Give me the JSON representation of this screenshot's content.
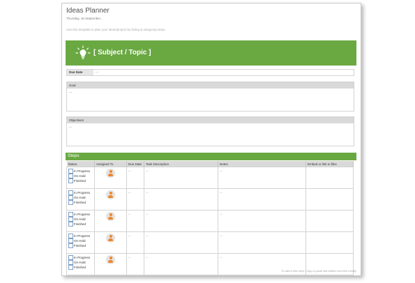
{
  "header": {
    "title": "Ideas Planner",
    "date": "Thursday, 15 September ,",
    "hint": "Use this template to plan your ideas/project by listing & assigning steps"
  },
  "banner": {
    "title": "[ Subject / Topic ]",
    "color": "#6aa842",
    "icon": "lightbulb-icon"
  },
  "due": {
    "label": "Due Date",
    "value": "..."
  },
  "goal": {
    "label": "Goal",
    "value": "..."
  },
  "objectives": {
    "label": "Objectives",
    "value": "..."
  },
  "steps": {
    "title": "Steps",
    "columns": {
      "status": "Status",
      "assigned": "Assigned To",
      "due": "Due Date",
      "task": "Task Description",
      "notes": "Notes",
      "files": "Embed or link to files"
    },
    "status_options": [
      "In Progress",
      "On Hold",
      "Finished"
    ],
    "rows": [
      {
        "due": "...",
        "task": "...",
        "notes": "..."
      },
      {
        "due": "...",
        "task": "...",
        "notes": "..."
      },
      {
        "due": "...",
        "task": "...",
        "notes": "..."
      },
      {
        "due": "...",
        "task": "...",
        "notes": "..."
      },
      {
        "due": "...",
        "task": "...",
        "notes": "..."
      }
    ]
  },
  "footer": {
    "note": "To add a new step: Copy & paste last dotted row then modify"
  },
  "colors": {
    "accent": "#6aa842",
    "avatar": "#f0852b"
  }
}
